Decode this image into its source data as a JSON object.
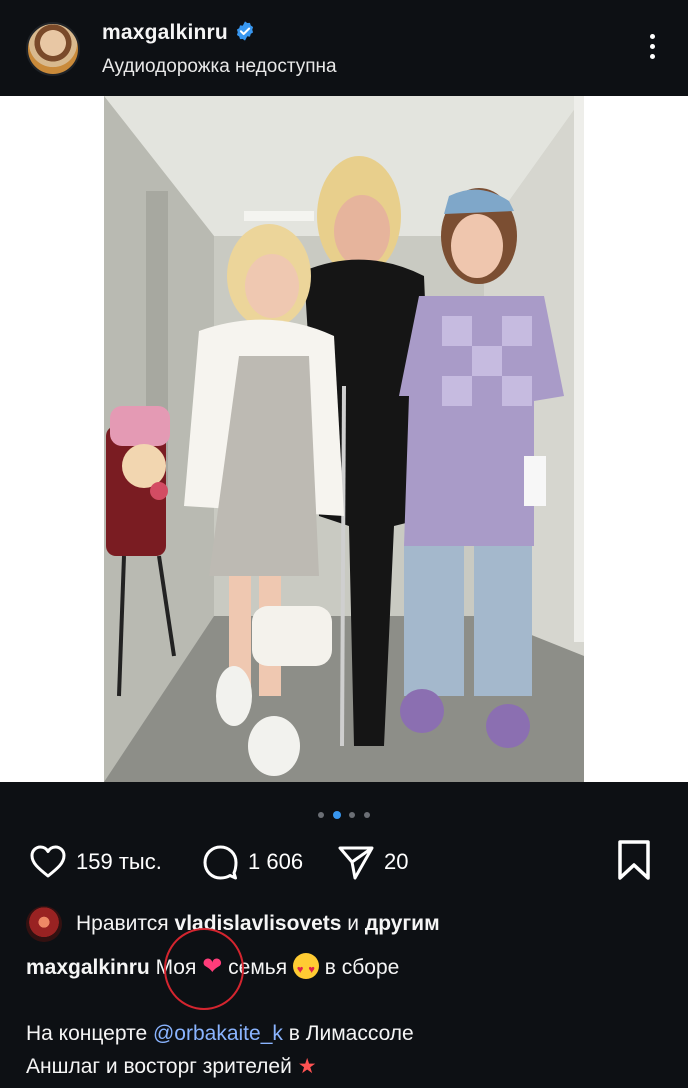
{
  "header": {
    "username": "maxgalkinru",
    "subtitle": "Аудиодорожка недоступна"
  },
  "icons": {
    "avatar": "profile-avatar",
    "verified": "verified-badge-icon",
    "more": "more-vertical-icon",
    "like": "heart-outline-icon",
    "comment": "comment-bubble-icon",
    "share": "paper-plane-icon",
    "save": "bookmark-outline-icon"
  },
  "carousel": {
    "total": 4,
    "active_index": 1
  },
  "actions": {
    "likes_count": "159 тыс.",
    "comments_count": "1 606",
    "shares_count": "20"
  },
  "likes": {
    "prefix": "Нравится",
    "liker": "vladislavlisovets",
    "joiner": "и",
    "suffix": "другим"
  },
  "caption": {
    "user": "maxgalkinru",
    "part1": "Моя",
    "part2": "семья",
    "part3": "в сборе"
  },
  "body": {
    "line1_prefix": "На концерте",
    "mention": "@orbakaite_k",
    "line1_suffix": "в Лимассоле",
    "line2": "Аншлаг и восторг зрителей"
  },
  "colors": {
    "background": "#0d1014",
    "accent": "#3897f0",
    "link": "#8ab4ff",
    "annotation": "#d4252f"
  }
}
